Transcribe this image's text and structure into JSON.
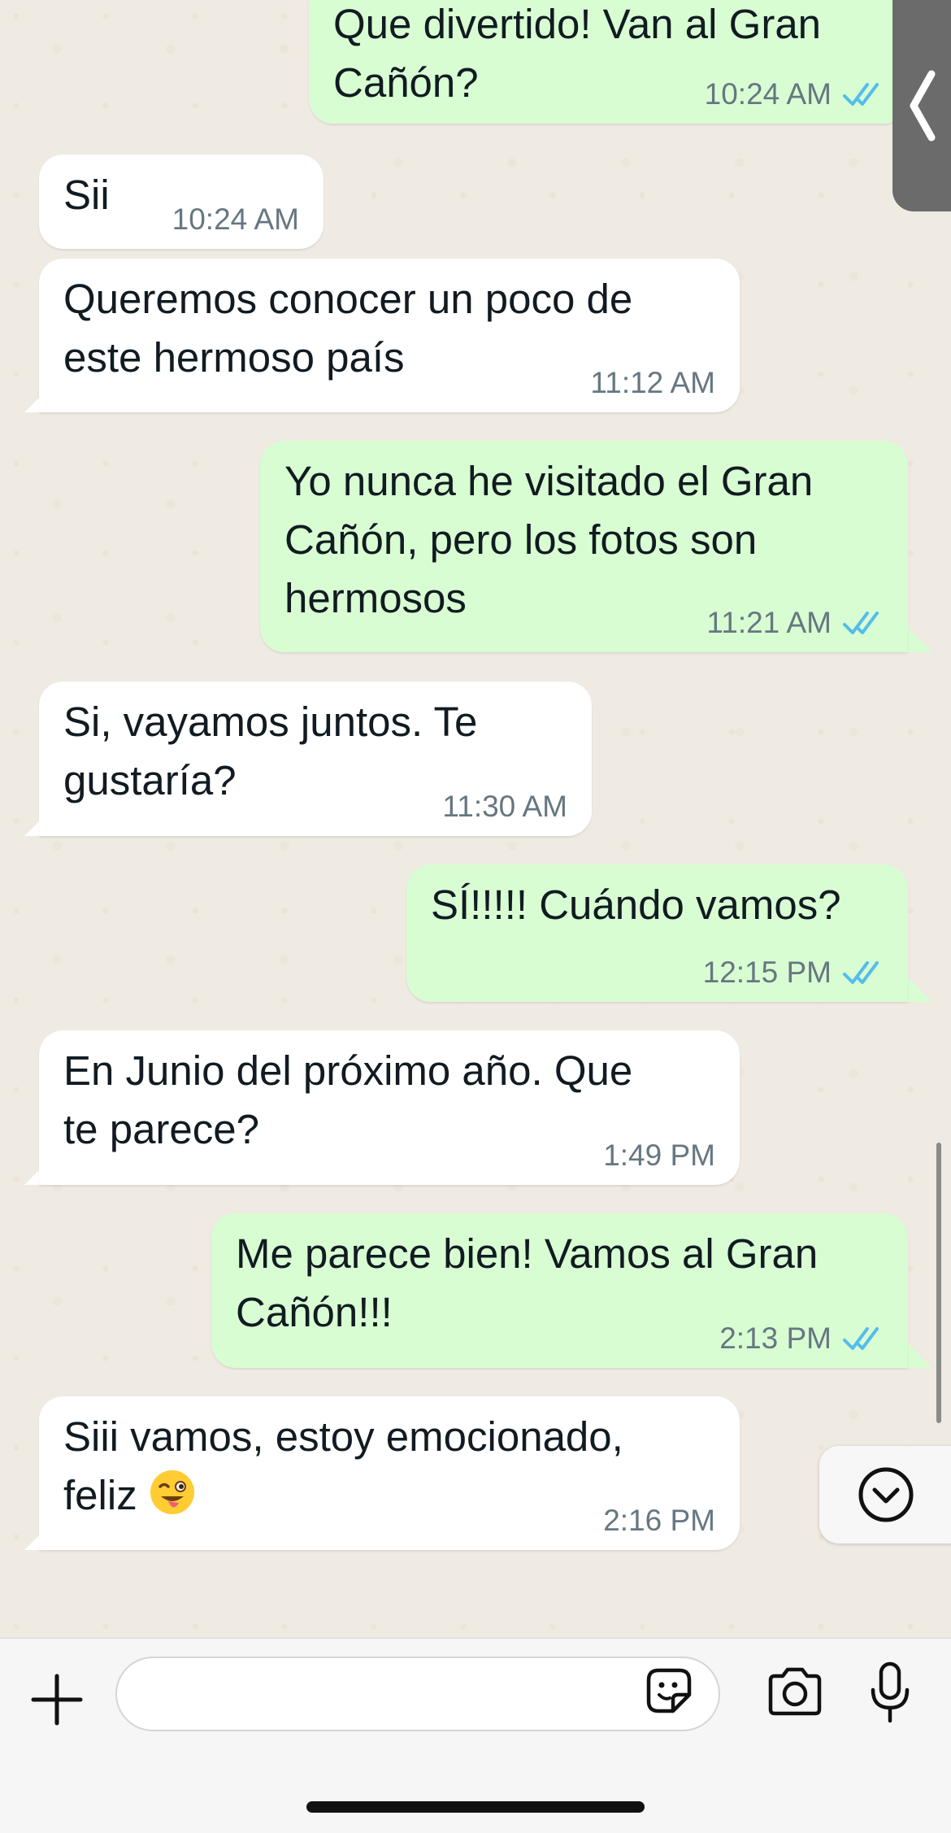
{
  "messages": [
    {
      "direction": "out",
      "text": "Que divertido! Van al Gran\nCañón?",
      "time": "10:24 AM",
      "read": true
    },
    {
      "direction": "in",
      "text": "Sii",
      "time": "10:24 AM"
    },
    {
      "direction": "in",
      "text": "Queremos conocer un poco de\neste hermoso país",
      "time": "11:12 AM"
    },
    {
      "direction": "out",
      "text": "Yo nunca he visitado el Gran\nCañón, pero los fotos son\nhermosos",
      "time": "11:21 AM",
      "read": true
    },
    {
      "direction": "in",
      "text": "Si, vayamos juntos. Te\ngustaría?",
      "time": "11:30 AM"
    },
    {
      "direction": "out",
      "text": "SÍ!!!!! Cuándo vamos?",
      "time": "12:15 PM",
      "read": true
    },
    {
      "direction": "in",
      "text": "En Junio del próximo año. Que\nte parece?",
      "time": "1:49 PM"
    },
    {
      "direction": "out",
      "text": "Me parece bien! Vamos al Gran\nCañón!!!",
      "time": "2:13 PM",
      "read": true
    },
    {
      "direction": "in",
      "text": "Siii vamos, estoy emocionado,\nfeliz",
      "emoji": "winking-face-with-tongue",
      "time": "2:16 PM"
    }
  ],
  "composer": {
    "input_value": "",
    "input_placeholder": ""
  },
  "colors": {
    "incoming_bubble": "#ffffff",
    "outgoing_bubble": "#d9fdd3",
    "read_ticks": "#53bdeb",
    "timestamp": "#667781",
    "wallpaper": "#efeae2"
  },
  "icons": {
    "side_tab": "chevron-left-icon",
    "scroll_down": "chevron-down-circle-icon",
    "attach": "plus-icon",
    "sticker": "sticker-icon",
    "camera": "camera-icon",
    "mic": "microphone-icon",
    "read_receipt": "double-check-icon"
  }
}
